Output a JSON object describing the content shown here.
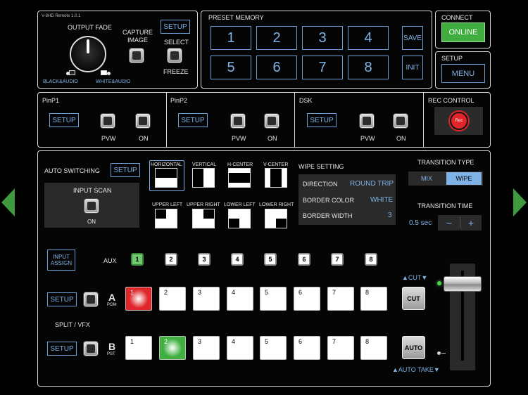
{
  "top": {
    "device_label": "V-8HD Remote 1.0.1",
    "output_fade": "OUTPUT FADE",
    "black_audio": "BLACK&AUDIO",
    "white_audio": "WHITE&AUDIO",
    "capture_image": "CAPTURE\nIMAGE",
    "setup": "SETUP",
    "select": "SELECT",
    "freeze": "FREEZE"
  },
  "preset": {
    "title": "PRESET MEMORY",
    "buttons": [
      "1",
      "2",
      "3",
      "4",
      "5",
      "6",
      "7",
      "8"
    ],
    "save": "SAVE",
    "init": "INIT"
  },
  "connect": {
    "title": "CONNECT",
    "status": "ONLINE"
  },
  "setup_menu": {
    "title": "SETUP",
    "menu": "MENU"
  },
  "pinp1": {
    "title": "PinP1",
    "setup": "SETUP",
    "pvw": "PVW",
    "on": "ON"
  },
  "pinp2": {
    "title": "PinP2",
    "setup": "SETUP",
    "pvw": "PVW",
    "on": "ON"
  },
  "dsk": {
    "title": "DSK",
    "setup": "SETUP",
    "pvw": "PVW",
    "on": "ON"
  },
  "rec": {
    "title": "REC CONTROL",
    "button": "Rec"
  },
  "auto_switching": {
    "title": "AUTO SWITCHING",
    "setup": "SETUP",
    "input_scan": "INPUT SCAN",
    "on": "ON"
  },
  "wipe_patterns": [
    "HORIZONTAL",
    "VERTICAL",
    "H-CENTER",
    "V-CENTER",
    "UPPER LEFT",
    "UPPER RIGHT",
    "LOWER LEFT",
    "LOWER RIGHT"
  ],
  "wipe_setting": {
    "title": "WIPE SETTING",
    "direction_label": "DIRECTION",
    "direction_value": "ROUND TRIP",
    "border_color_label": "BORDER COLOR",
    "border_color_value": "WHITE",
    "border_width_label": "BORDER WIDTH",
    "border_width_value": "3"
  },
  "transition": {
    "type_title": "TRANSITION TYPE",
    "mix": "MIX",
    "wipe": "WIPE",
    "time_title": "TRANSITION TIME",
    "time_value": "0.5 sec",
    "minus": "−",
    "plus": "+"
  },
  "bus": {
    "input_assign": "INPUT\nASSIGN",
    "aux_label": "AUX",
    "aux_buttons": [
      "1",
      "2",
      "3",
      "4",
      "5",
      "6",
      "7",
      "8"
    ],
    "setup": "SETUP",
    "a": "A",
    "pgm": "PGM",
    "b": "B",
    "pst": "PST",
    "split_vfx": "SPLIT / VFX",
    "a_buttons": [
      "1",
      "2",
      "3",
      "4",
      "5",
      "6",
      "7",
      "8"
    ],
    "b_buttons": [
      "1",
      "2",
      "3",
      "4",
      "5",
      "6",
      "7",
      "8"
    ],
    "cut_label": "▲CUT▼",
    "cut": "CUT",
    "auto": "AUTO",
    "auto_take": "▲AUTO TAKE▼"
  },
  "colors": {
    "accent": "#7fb3e8",
    "online": "#3fae3f",
    "pgm": "#e0262b",
    "pst": "#3fb03f",
    "nav_arrow": "#3f9a3f"
  },
  "icons": {
    "prev": "chevron-left-icon",
    "next": "chevron-right-icon"
  }
}
